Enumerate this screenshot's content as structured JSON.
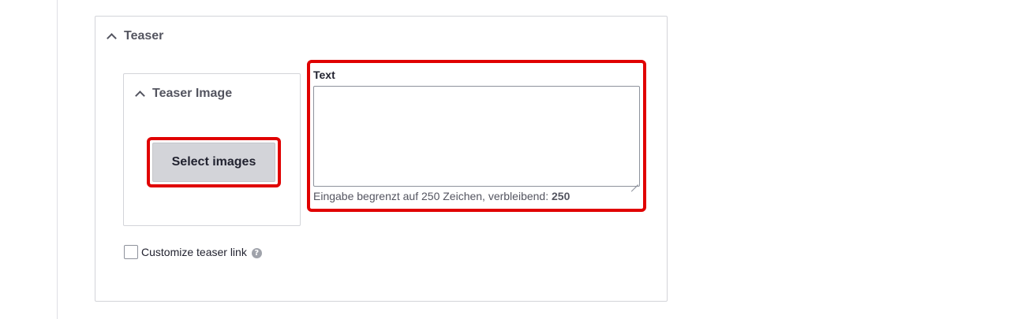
{
  "teaser": {
    "title": "Teaser",
    "image_panel": {
      "title": "Teaser Image",
      "select_button": "Select images"
    },
    "text_field": {
      "label": "Text",
      "value": "",
      "help_prefix": "Eingabe begrenzt auf 250 Zeichen, verbleibend: ",
      "help_count": "250"
    },
    "customize_link": {
      "label": "Customize teaser link",
      "checked": false,
      "help_icon": "question-circle-icon",
      "help_glyph": "?"
    }
  },
  "colors": {
    "highlight": "#e00000",
    "button_bg": "#d3d4d9",
    "panel_border": "#d3d4d9",
    "text_muted": "#545560"
  }
}
